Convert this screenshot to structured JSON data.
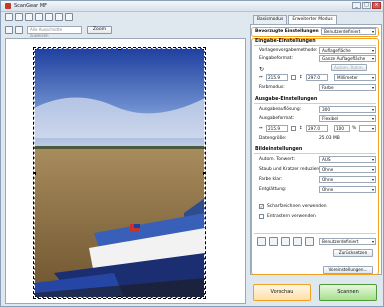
{
  "window": {
    "title": "ScanGear MF"
  },
  "toolbar": {
    "autocrop_placeholder": "Alle Ausschnitte zuweisen",
    "zoom_label": "Zoom"
  },
  "tabs": [
    {
      "label": "Basismodus"
    },
    {
      "label": "Erweiterter Modus"
    }
  ],
  "favorites": {
    "label": "Bevorzugte Einstellungen",
    "value": "Benutzerdefiniert"
  },
  "input": {
    "header": "Eingabe-Einstellungen",
    "preview_label": "Vorlagenvorgabemethode:",
    "preview_value": "Auflagefläche",
    "format_label": "Eingabeformat:",
    "format_value": "Ganze Auflagefläche",
    "auto_label": "Autom. Rahm.",
    "width": "215.9",
    "height": "297.0",
    "unit": "Millimeter",
    "color_label": "Farbmodus:",
    "color_value": "Farbe"
  },
  "output": {
    "header": "Ausgabe-Einstellungen",
    "res_label": "Ausgabeauflösung:",
    "res_value": "300",
    "size_label": "Ausgabeformat:",
    "size_value": "Flexibel",
    "width": "215.9",
    "height": "297.0",
    "scale": "100",
    "filesize_label": "Datengröße:",
    "filesize_value": "25.03 MB"
  },
  "image": {
    "header": "Bildeinstellungen",
    "rows": [
      {
        "label": "Autom. Tonwert:",
        "value": "AUS"
      },
      {
        "label": "Staub und Kratzer reduzieren:",
        "value": "Ohne"
      },
      {
        "label": "Farbe klar:",
        "value": "Ohne"
      },
      {
        "label": "Entglättung:",
        "value": "Ohne"
      }
    ],
    "sharpen_label": "Scharfzeichnen verwenden",
    "descreen_label": "Entrastern verwenden"
  },
  "adjust": {
    "custom_value": "Benutzerdefiniert",
    "reset_label": "Zurücksetzen"
  },
  "preferences_label": "Voreinstellungen...",
  "preview_button": "Vorschau",
  "scan_button": "Scannen",
  "colors": {
    "accent": "#f4a21f",
    "sky": "#2a4fb8",
    "water": "#8a6a3a"
  }
}
